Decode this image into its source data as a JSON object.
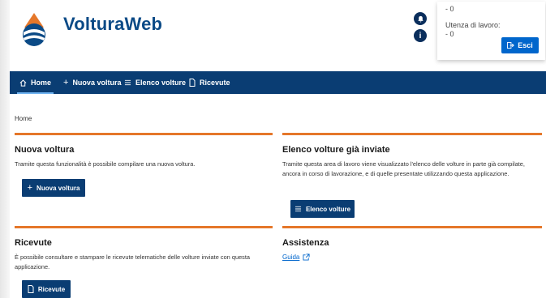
{
  "header": {
    "app_title": "VolturaWeb",
    "user": {
      "top_value": "- 0",
      "workspace_label": "Utenza di lavoro:",
      "workspace_value": "- 0",
      "logout_label": "Esci"
    }
  },
  "nav": {
    "items": [
      {
        "label": "Home",
        "icon": "home-icon"
      },
      {
        "label": "Nuova voltura",
        "icon": "plus-icon"
      },
      {
        "label": "Elenco volture",
        "icon": "list-icon"
      },
      {
        "label": "Ricevute",
        "icon": "document-icon"
      }
    ]
  },
  "breadcrumb": "Home",
  "cards": {
    "nuova": {
      "title": "Nuova voltura",
      "text": "Tramite questa funzionalità è possibile compilare una nuova voltura.",
      "button": "Nuova voltura"
    },
    "elenco": {
      "title": "Elenco volture già inviate",
      "text": "Tramite questa area di lavoro viene visualizzato l'elenco delle volture in parte già compilate, ancora in corso di lavorazione, e di quelle presentate utilizzando questa applicazione.",
      "button": "Elenco volture"
    },
    "ricevute": {
      "title": "Ricevute",
      "text": "È possibile consultare e stampare le ricevute telematiche delle volture inviate con questa applicazione.",
      "button": "Ricevute"
    },
    "assistenza": {
      "title": "Assistenza",
      "link": "Guida"
    }
  },
  "colors": {
    "brand": "#0b4a86",
    "navbar": "#0a3d73",
    "accent_bar": "#e5772a",
    "primary_button": "#0066cc"
  }
}
